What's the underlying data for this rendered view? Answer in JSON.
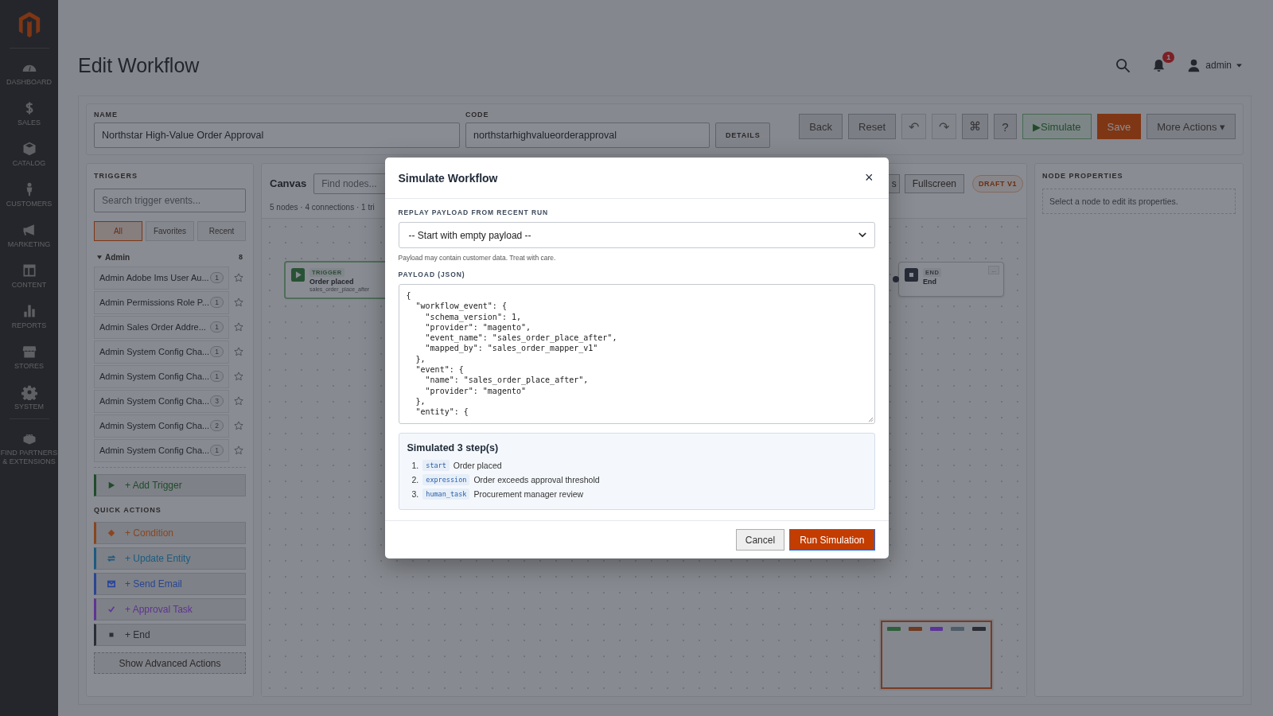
{
  "sidebar": {
    "items": [
      {
        "label": "DASHBOARD",
        "kind": "dashboard"
      },
      {
        "label": "SALES",
        "kind": "sales"
      },
      {
        "label": "CATALOG",
        "kind": "catalog"
      },
      {
        "label": "CUSTOMERS",
        "kind": "customers"
      },
      {
        "label": "MARKETING",
        "kind": "marketing"
      },
      {
        "label": "CONTENT",
        "kind": "content"
      },
      {
        "label": "REPORTS",
        "kind": "reports"
      },
      {
        "label": "STORES",
        "kind": "stores"
      },
      {
        "label": "SYSTEM",
        "kind": "system"
      },
      {
        "label": "FIND PARTNERS & EXTENSIONS",
        "kind": "partners"
      }
    ]
  },
  "header": {
    "title": "Edit Workflow",
    "notifications": "1",
    "user": "admin"
  },
  "workflow": {
    "name_label": "NAME",
    "name": "Northstar High-Value Order Approval",
    "code_label": "CODE",
    "code": "northstarhighvalueorderapproval",
    "details_button": "DETAILS"
  },
  "toolbar": [
    {
      "label": "Back",
      "kind": "plain",
      "disabled": false
    },
    {
      "label": "Reset",
      "kind": "plain",
      "disabled": false
    },
    {
      "label": "↶",
      "kind": "icon",
      "disabled": true
    },
    {
      "label": "↷",
      "kind": "icon",
      "disabled": true
    },
    {
      "label": "⌘",
      "kind": "icon",
      "disabled": false
    },
    {
      "label": "?",
      "kind": "icon",
      "disabled": false
    },
    {
      "label": "▶Simulate",
      "kind": "success",
      "disabled": false
    },
    {
      "label": "Save",
      "kind": "primary",
      "disabled": false
    },
    {
      "label": "More Actions ▾",
      "kind": "plain",
      "disabled": false
    }
  ],
  "triggers": {
    "title": "TRIGGERS",
    "search_placeholder": "Search trigger events...",
    "filters": [
      {
        "label": "All",
        "selected": true
      },
      {
        "label": "Favorites",
        "selected": false
      },
      {
        "label": "Recent",
        "selected": false
      }
    ],
    "group": {
      "name": "Admin",
      "count": "8",
      "expanded": true,
      "items": [
        {
          "name": "Admin Adobe Ims User Au...",
          "count": "1",
          "favorite": false
        },
        {
          "name": "Admin Permissions Role P...",
          "count": "1",
          "favorite": false
        },
        {
          "name": "Admin Sales Order Addre...",
          "count": "1",
          "favorite": false
        },
        {
          "name": "Admin System Config Cha...",
          "count": "1",
          "favorite": false
        },
        {
          "name": "Admin System Config Cha...",
          "count": "1",
          "favorite": false
        },
        {
          "name": "Admin System Config Cha...",
          "count": "3",
          "favorite": false
        },
        {
          "name": "Admin System Config Cha...",
          "count": "2",
          "favorite": false
        },
        {
          "name": "Admin System Config Cha...",
          "count": "1",
          "favorite": false
        }
      ]
    },
    "add_button": "+ Add Trigger"
  },
  "quick_actions": {
    "title": "QUICK ACTIONS",
    "items": [
      {
        "label": "+ Condition",
        "kind": "condition",
        "color": "#8c4520"
      },
      {
        "label": "+ Update Entity",
        "kind": "update",
        "color": "#1d5b80"
      },
      {
        "label": "+ Send Email",
        "kind": "email",
        "color": "#2a45a0"
      },
      {
        "label": "+ Approval Task",
        "kind": "approval",
        "color": "#5e34a0"
      },
      {
        "label": "+ End",
        "kind": "end",
        "color": "#2a2e36"
      }
    ],
    "advanced_button": "Show Advanced Actions"
  },
  "canvas": {
    "title": "Canvas",
    "search_placeholder": "Find nodes...",
    "summary": "5 nodes · 4 connections · 1 tri",
    "buttons": [
      "s",
      "Fullscreen"
    ],
    "status": "DRAFT V1",
    "nodes": [
      {
        "kind": "trigger",
        "tag": "TRIGGER",
        "label": "Order placed",
        "sub": "sales_order_place_after"
      },
      {
        "kind": "end",
        "tag": "END",
        "label": "End",
        "menu": "..."
      }
    ],
    "minimap": [
      {
        "color": "#2f5e3a"
      },
      {
        "color": "#6e3a22"
      },
      {
        "color": "#5c3399"
      },
      {
        "color": "#4f5d68"
      },
      {
        "color": "#2a2d35"
      }
    ]
  },
  "node_properties": {
    "title": "NODE PROPERTIES",
    "empty": "Select a node to edit its properties."
  },
  "modal": {
    "title": "Simulate Workflow",
    "close": "×",
    "replay_label": "REPLAY PAYLOAD FROM RECENT RUN",
    "replay_value": "-- Start with empty payload --",
    "hint": "Payload may contain customer data. Treat with care.",
    "payload_label": "PAYLOAD (JSON)",
    "payload": "{\n  \"workflow_event\": {\n    \"schema_version\": 1,\n    \"provider\": \"magento\",\n    \"event_name\": \"sales_order_place_after\",\n    \"mapped_by\": \"sales_order_mapper_v1\"\n  },\n  \"event\": {\n    \"name\": \"sales_order_place_after\",\n    \"provider\": \"magento\"\n  },\n  \"entity\": {",
    "result_title": "Simulated 3 step(s)",
    "steps": [
      {
        "number": "1.",
        "type": "start",
        "label": "Order placed"
      },
      {
        "number": "2.",
        "type": "expression",
        "label": "Order exceeds approval threshold"
      },
      {
        "number": "3.",
        "type": "human_task",
        "label": "Procurement manager review"
      }
    ],
    "cancel": "Cancel",
    "run": "Run Simulation"
  }
}
